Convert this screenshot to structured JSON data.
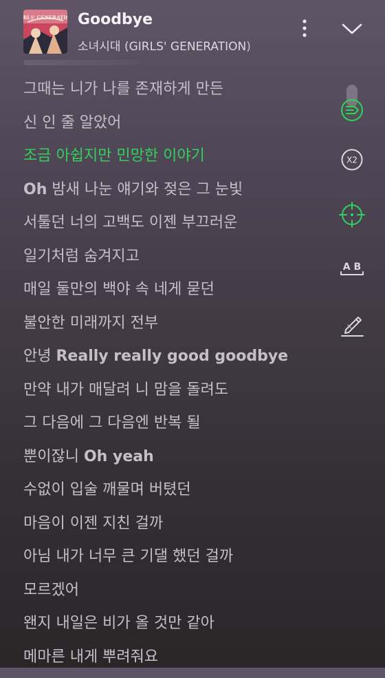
{
  "header": {
    "title": "Goodbye",
    "artist": "소녀시대 (GIRLS' GENERATION)",
    "album_art_text": "GIRLS' GENERATION"
  },
  "lyrics": [
    {
      "parts": [
        {
          "text": "그때는 니가 나를 존재하게 만든",
          "en": false
        }
      ]
    },
    {
      "parts": [
        {
          "text": "신 인 줄 알았어",
          "en": false
        }
      ]
    },
    {
      "parts": [
        {
          "text": "조금 아쉽지만 민망한 이야기",
          "en": false
        }
      ],
      "active": true
    },
    {
      "parts": [
        {
          "text": "Oh",
          "en": true
        },
        {
          "text": " 밤새 나눈 얘기와 젖은 그 눈빛",
          "en": false
        }
      ]
    },
    {
      "parts": [
        {
          "text": "서툴던 너의 고백도 이젠 부끄러운",
          "en": false
        }
      ]
    },
    {
      "parts": [
        {
          "text": "일기처럼 숨겨지고",
          "en": false
        }
      ]
    },
    {
      "parts": [
        {
          "text": "매일 둘만의 백야 속 네게 묻던",
          "en": false
        }
      ]
    },
    {
      "parts": [
        {
          "text": "불안한 미래까지 전부",
          "en": false
        }
      ]
    },
    {
      "parts": [
        {
          "text": "안녕 ",
          "en": false
        },
        {
          "text": "Really really good goodbye",
          "en": true
        }
      ]
    },
    {
      "parts": [
        {
          "text": "만약 내가 매달려 니 맘을 돌려도",
          "en": false
        }
      ]
    },
    {
      "parts": [
        {
          "text": "그 다음에 그 다음엔 반복 될",
          "en": false
        }
      ]
    },
    {
      "parts": [
        {
          "text": "뿐이잖니 ",
          "en": false
        },
        {
          "text": "Oh yeah",
          "en": true
        }
      ]
    },
    {
      "parts": [
        {
          "text": "수없이 입술 깨물며 버텼던",
          "en": false
        }
      ]
    },
    {
      "parts": [
        {
          "text": "마음이 이젠 지친 걸까",
          "en": false
        }
      ]
    },
    {
      "parts": [
        {
          "text": "아님 내가 너무 큰 기댈 했던 걸까",
          "en": false
        }
      ]
    },
    {
      "parts": [
        {
          "text": "모르겠어",
          "en": false
        }
      ]
    },
    {
      "parts": [
        {
          "text": "왠지 내일은 비가 올 것만 같아",
          "en": false
        }
      ]
    },
    {
      "parts": [
        {
          "text": "메마른 내게 뿌려줘요",
          "en": false
        }
      ]
    }
  ],
  "tools": {
    "speed_label": "X2",
    "translate_label": "A B"
  },
  "colors": {
    "accent": "#33d05c",
    "lyric": "#c6bfc8",
    "title": "#f4f2f5",
    "icon": "#dcd6de"
  },
  "icons": [
    "more-vertical-icon",
    "chevron-down-icon",
    "auto-scroll-icon",
    "speed-icon",
    "crosshair-icon",
    "translate-icon",
    "pen-icon"
  ]
}
